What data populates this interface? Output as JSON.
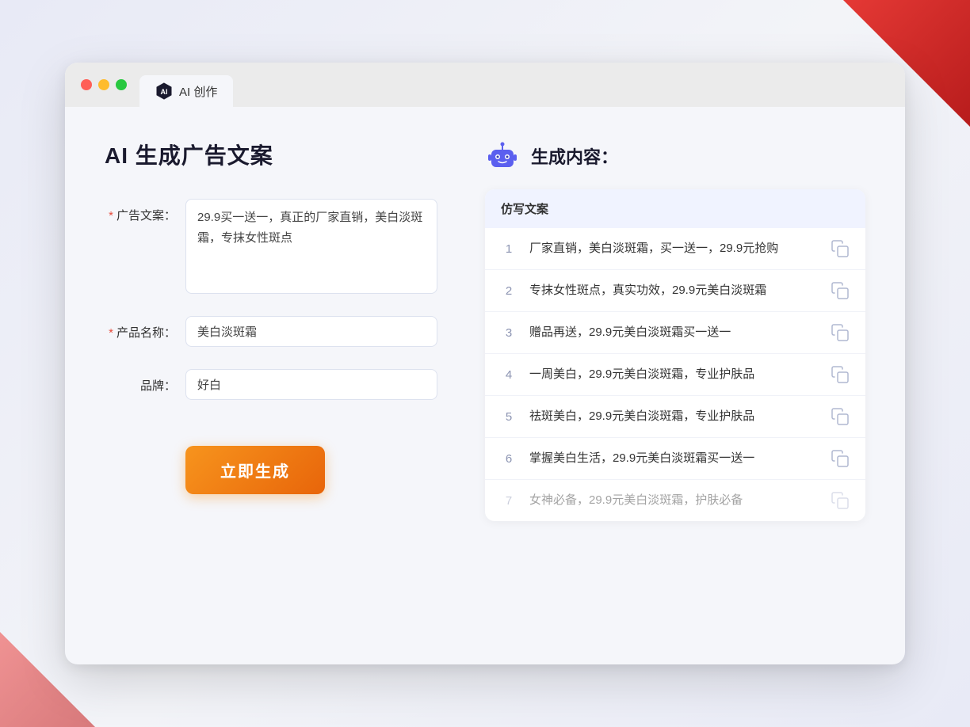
{
  "window": {
    "tab_label": "AI 创作"
  },
  "left_panel": {
    "page_title": "AI 生成广告文案",
    "form": {
      "ad_copy_label": "广告文案：",
      "ad_copy_required": "*",
      "ad_copy_value": "29.9买一送一，真正的厂家直销，美白淡斑霜，专抹女性斑点",
      "product_name_label": "产品名称：",
      "product_name_required": "*",
      "product_name_value": "美白淡斑霜",
      "brand_label": "品牌：",
      "brand_value": "好白",
      "generate_button": "立即生成"
    }
  },
  "right_panel": {
    "title": "生成内容：",
    "table_header": "仿写文案",
    "rows": [
      {
        "num": "1",
        "text": "厂家直销，美白淡斑霜，买一送一，29.9元抢购"
      },
      {
        "num": "2",
        "text": "专抹女性斑点，真实功效，29.9元美白淡斑霜"
      },
      {
        "num": "3",
        "text": "赠品再送，29.9元美白淡斑霜买一送一"
      },
      {
        "num": "4",
        "text": "一周美白，29.9元美白淡斑霜，专业护肤品"
      },
      {
        "num": "5",
        "text": "祛斑美白，29.9元美白淡斑霜，专业护肤品"
      },
      {
        "num": "6",
        "text": "掌握美白生活，29.9元美白淡斑霜买一送一"
      },
      {
        "num": "7",
        "text": "女神必备，29.9元美白淡斑霜，护肤必备"
      }
    ]
  }
}
